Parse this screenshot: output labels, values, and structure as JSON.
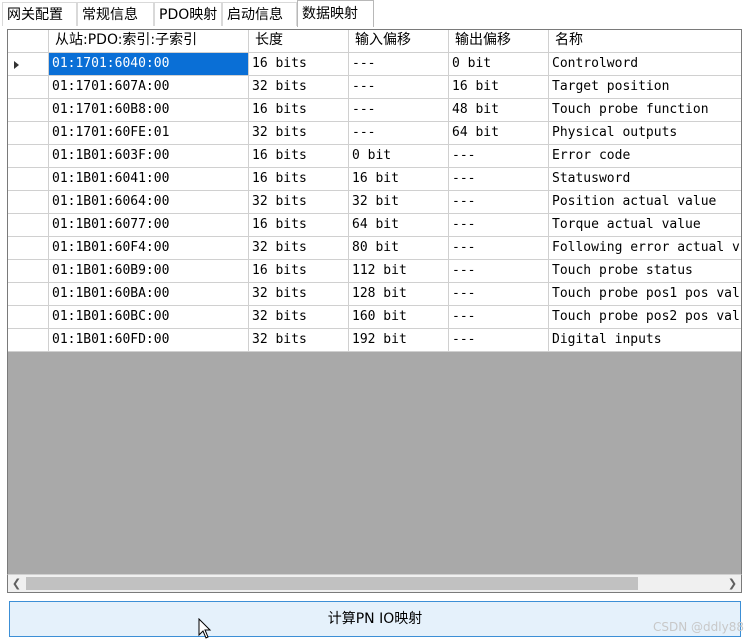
{
  "tabs": [
    {
      "label": "网关配置"
    },
    {
      "label": "常规信息"
    },
    {
      "label": "PDO映射"
    },
    {
      "label": "启动信息"
    },
    {
      "label": "数据映射"
    }
  ],
  "active_tab": "数据映射",
  "table": {
    "columns": [
      "",
      "从站:PDO:索引:子索引",
      "长度",
      "输入偏移",
      "输出偏移",
      "名称"
    ],
    "rows": [
      {
        "index": "01:1701:6040:00",
        "length": "16 bits",
        "input_offset": "---",
        "output_offset": "0 bit",
        "name": "Controlword"
      },
      {
        "index": "01:1701:607A:00",
        "length": "32 bits",
        "input_offset": "---",
        "output_offset": "16 bit",
        "name": "Target position"
      },
      {
        "index": "01:1701:60B8:00",
        "length": "16 bits",
        "input_offset": "---",
        "output_offset": "48 bit",
        "name": "Touch probe function"
      },
      {
        "index": "01:1701:60FE:01",
        "length": "32 bits",
        "input_offset": "---",
        "output_offset": "64 bit",
        "name": "Physical outputs"
      },
      {
        "index": "01:1B01:603F:00",
        "length": "16 bits",
        "input_offset": "0 bit",
        "output_offset": "---",
        "name": "Error code"
      },
      {
        "index": "01:1B01:6041:00",
        "length": "16 bits",
        "input_offset": "16 bit",
        "output_offset": "---",
        "name": "Statusword"
      },
      {
        "index": "01:1B01:6064:00",
        "length": "32 bits",
        "input_offset": "32 bit",
        "output_offset": "---",
        "name": "Position actual value"
      },
      {
        "index": "01:1B01:6077:00",
        "length": "16 bits",
        "input_offset": "64 bit",
        "output_offset": "---",
        "name": "Torque actual value"
      },
      {
        "index": "01:1B01:60F4:00",
        "length": "32 bits",
        "input_offset": "80 bit",
        "output_offset": "---",
        "name": "Following error actual v"
      },
      {
        "index": "01:1B01:60B9:00",
        "length": "16 bits",
        "input_offset": "112 bit",
        "output_offset": "---",
        "name": "Touch probe status"
      },
      {
        "index": "01:1B01:60BA:00",
        "length": "32 bits",
        "input_offset": "128 bit",
        "output_offset": "---",
        "name": "Touch probe pos1 pos val"
      },
      {
        "index": "01:1B01:60BC:00",
        "length": "32 bits",
        "input_offset": "160 bit",
        "output_offset": "---",
        "name": "Touch probe pos2 pos val"
      },
      {
        "index": "01:1B01:60FD:00",
        "length": "32 bits",
        "input_offset": "192 bit",
        "output_offset": "---",
        "name": "Digital inputs"
      }
    ],
    "selected_row": 0
  },
  "scrollbar": {
    "left_icon": "chevron-left-icon",
    "right_icon": "chevron-right-icon"
  },
  "calc_button": {
    "label": "计算PN IO映射"
  },
  "watermark": "CSDN @ddly88",
  "colors": {
    "selection": "#0a6fd6",
    "grid_background": "#a9a9a9",
    "button_bg": "#e5f1fb",
    "button_border": "#3c8fd6"
  }
}
